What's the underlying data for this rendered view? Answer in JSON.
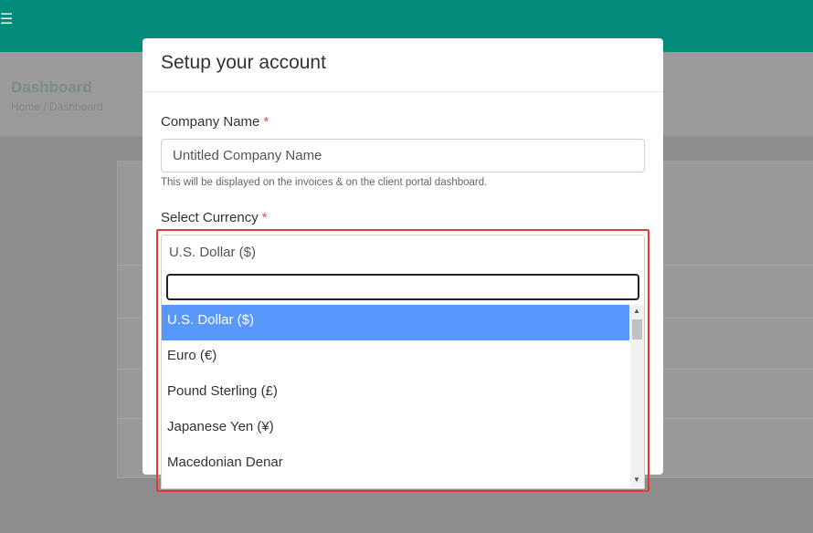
{
  "background": {
    "menu_icon": "hamburger-icon",
    "page_title": "Dashboard",
    "breadcrumb": [
      "Home",
      "Dashboard"
    ]
  },
  "modal": {
    "title": "Setup your account",
    "company_name": {
      "label": "Company Name",
      "required_mark": "*",
      "value": "Untitled Company Name",
      "hint": "This will be displayed on the invoices & on the client portal dashboard."
    },
    "currency": {
      "label": "Select Currency",
      "required_mark": "*",
      "selected": "U.S. Dollar ($)",
      "search_value": "",
      "options": [
        "U.S. Dollar ($)",
        "Euro (€)",
        "Pound Sterling (£)",
        "Japanese Yen (¥)",
        "Macedonian Denar"
      ],
      "highlighted_index": 0
    }
  },
  "colors": {
    "topbar": "#008b7b",
    "selected_option": "#5897fb",
    "required": "#d9534f",
    "highlight_box": "#e53935"
  }
}
